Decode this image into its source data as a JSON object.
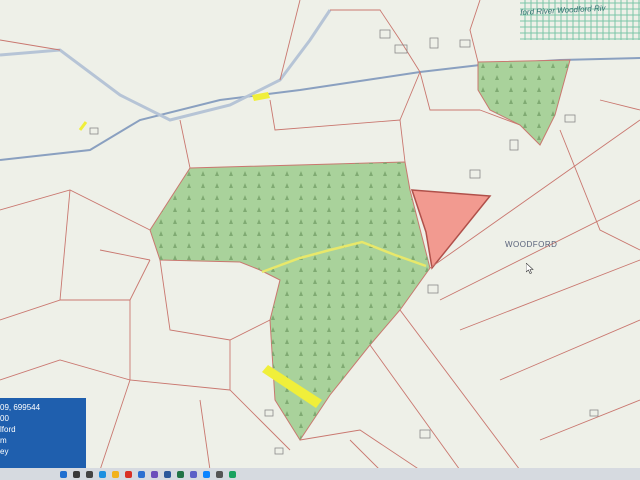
{
  "map": {
    "townland_label": "WOODFORD",
    "river_label": "ford River Woodford Riv",
    "colors": {
      "forestry": "#a9d29b",
      "selected_plot": "#f29a90",
      "track": "#e8e86a",
      "boundary": "#c9776f",
      "road": "#8aa0c0",
      "water_hatch": "#7cc6a8"
    }
  },
  "info_panel": {
    "lines": [
      "09, 699544",
      "00",
      "lford",
      "m",
      "ey"
    ]
  },
  "taskbar": {
    "icons": [
      "start-icon",
      "search-icon",
      "task-view-icon",
      "edge-icon",
      "explorer-icon",
      "chrome-icon",
      "mail-icon",
      "store-icon",
      "word-icon",
      "excel-icon",
      "teams-icon",
      "photos-icon",
      "settings-icon",
      "maps-icon"
    ],
    "icon_colors": [
      "#1f6fd0",
      "#3a3a3a",
      "#444444",
      "#1c8fe0",
      "#f2b21c",
      "#d93025",
      "#2b6fd1",
      "#6b4fbb",
      "#2b579a",
      "#217346",
      "#5b5fc7",
      "#0a84ff",
      "#555555",
      "#1aa260"
    ]
  }
}
